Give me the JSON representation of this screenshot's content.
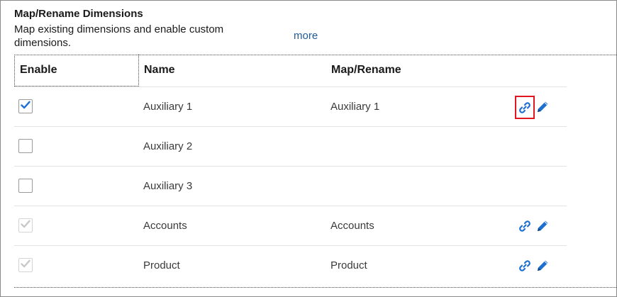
{
  "section": {
    "title": "Map/Rename Dimensions",
    "description": "Map existing dimensions and enable custom dimensions.",
    "more_label": "more"
  },
  "table": {
    "headers": {
      "enable": "Enable",
      "name": "Name",
      "map": "Map/Rename"
    },
    "rows": [
      {
        "name": "Auxiliary 1",
        "map": "Auxiliary 1",
        "checked": true,
        "disabled": false,
        "has_actions": true,
        "link_highlighted": true
      },
      {
        "name": "Auxiliary 2",
        "map": "",
        "checked": false,
        "disabled": false,
        "has_actions": false,
        "link_highlighted": false
      },
      {
        "name": "Auxiliary 3",
        "map": "",
        "checked": false,
        "disabled": false,
        "has_actions": false,
        "link_highlighted": false
      },
      {
        "name": "Accounts",
        "map": "Accounts",
        "checked": true,
        "disabled": true,
        "has_actions": true,
        "link_highlighted": false
      },
      {
        "name": "Product",
        "map": "Product",
        "checked": true,
        "disabled": true,
        "has_actions": true,
        "link_highlighted": false
      }
    ]
  },
  "icons": {
    "link": "link-icon",
    "edit": "pencil-icon",
    "check": "checkmark-icon"
  },
  "colors": {
    "accent": "#1f6fd1",
    "check_enabled": "#1b6fd6",
    "check_disabled": "#c8c8c8",
    "highlight": "#e0151d",
    "link_text": "#1f5b9a"
  }
}
